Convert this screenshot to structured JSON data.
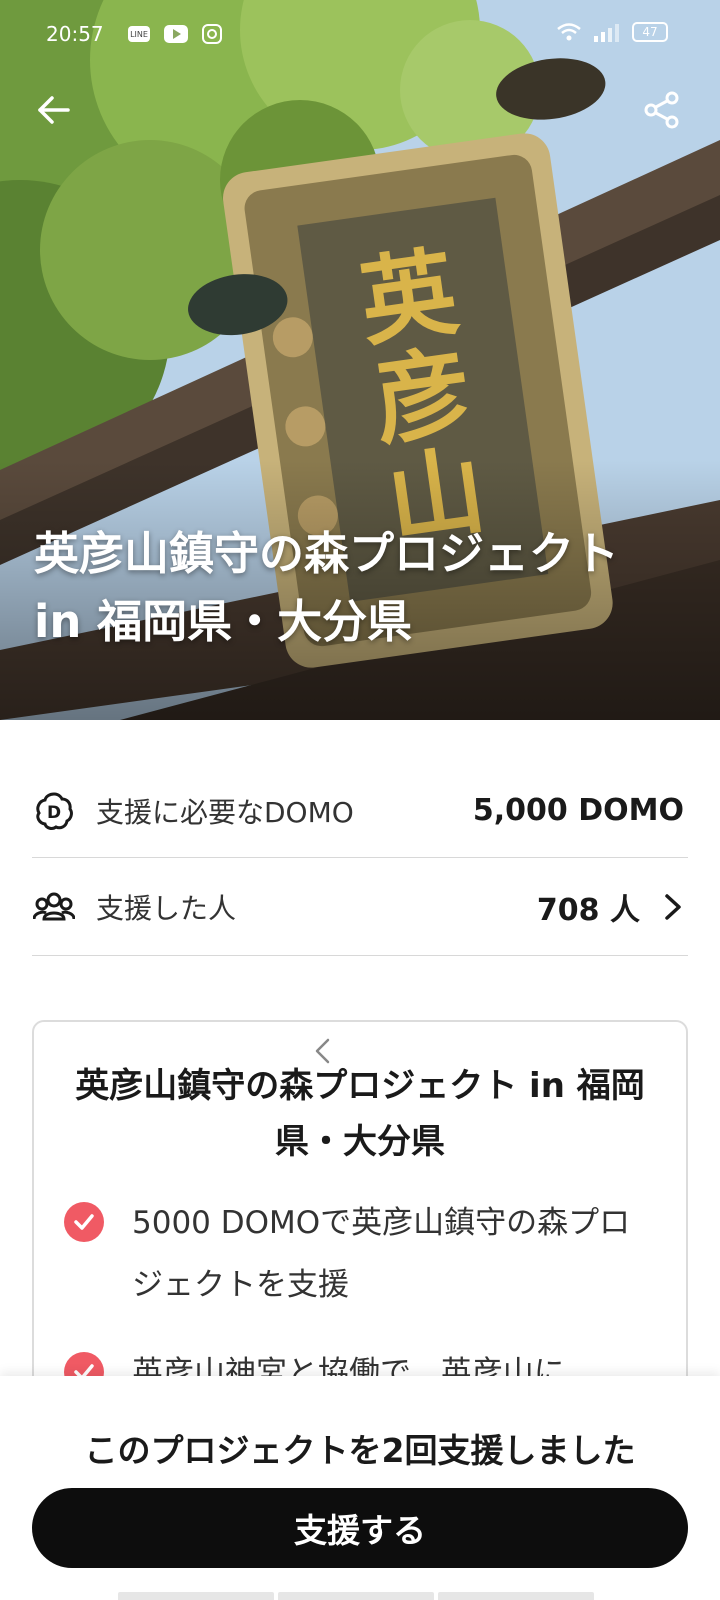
{
  "status_bar": {
    "time": "20:57",
    "battery": "47"
  },
  "hero": {
    "title": "英彦山鎮守の森プロジェクト in 福岡県・大分県",
    "plaque_text": "英彦山"
  },
  "info": {
    "domo_label": "支援に必要なDOMO",
    "domo_value": "5,000 DOMO",
    "supporters_label": "支援した人",
    "supporters_value": "708 人"
  },
  "card": {
    "title": "英彦山鎮守の森プロジェクト in 福岡県・大分県",
    "benefits": [
      "5000 DOMOで英彦山鎮守の森プロジェクトを支援",
      "英彦山神宮と協働で、英彦山に"
    ]
  },
  "bottom": {
    "support_count_text": "このプロジェクトを2回支援しました",
    "support_button": "支援する"
  },
  "colors": {
    "accent_check": "#f05a64",
    "button_bg": "#0d0d0d"
  },
  "icons": {
    "back": "arrow-left-icon",
    "share": "share-icon",
    "domo": "domo-flower-icon",
    "supporters": "people-icon",
    "chevron": "chevron-right-icon",
    "check": "check-circle-icon",
    "card_prev": "chevron-left-icon"
  }
}
